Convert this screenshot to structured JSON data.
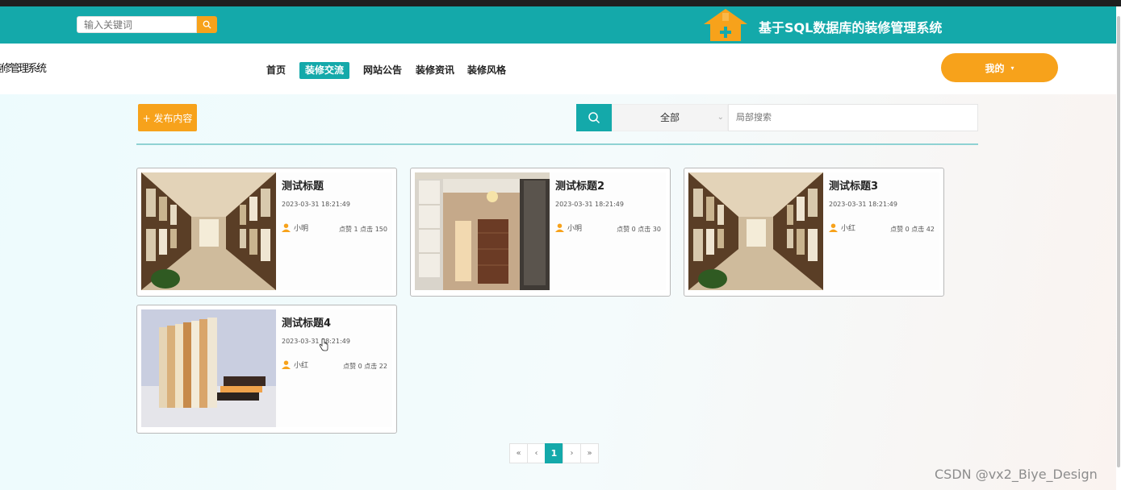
{
  "topbar": {
    "search_placeholder": "输入关键词",
    "site_title": "基于SQL数据库的装修管理系统"
  },
  "navbar": {
    "brand": "装修管理系统",
    "items": [
      "首页",
      "装修交流",
      "网站公告",
      "装修资讯",
      "装修风格"
    ],
    "active_index": 1,
    "me_label": "我的"
  },
  "toolbar": {
    "publish_label": "+ 发布内容",
    "category_value": "全部",
    "local_search_placeholder": "局部搜索"
  },
  "posts": [
    {
      "title": "测试标题",
      "time": "2023-03-31 18:21:49",
      "author": "小明",
      "stats": "点赞 1 点击 150",
      "image": "tile-showroom-corridor"
    },
    {
      "title": "测试标题2",
      "time": "2023-03-31 18:21:49",
      "author": "小明",
      "stats": "点赞 0 点击 30",
      "image": "wood-panel-display-room"
    },
    {
      "title": "测试标题3",
      "time": "2023-03-31 18:21:49",
      "author": "小红",
      "stats": "点赞 0 点击 42",
      "image": "tile-showroom-corridor"
    },
    {
      "title": "测试标题4",
      "time": "2023-03-31 18:21:49",
      "author": "小红",
      "stats": "点赞 0 点击 22",
      "image": "wood-board-samples"
    }
  ],
  "pagination": {
    "first": "«",
    "prev": "‹",
    "current": "1",
    "next": "›",
    "last": "»"
  },
  "watermark": "CSDN @vx2_Biye_Design",
  "colors": {
    "primary": "#14a9aa",
    "accent": "#f7a21b"
  }
}
